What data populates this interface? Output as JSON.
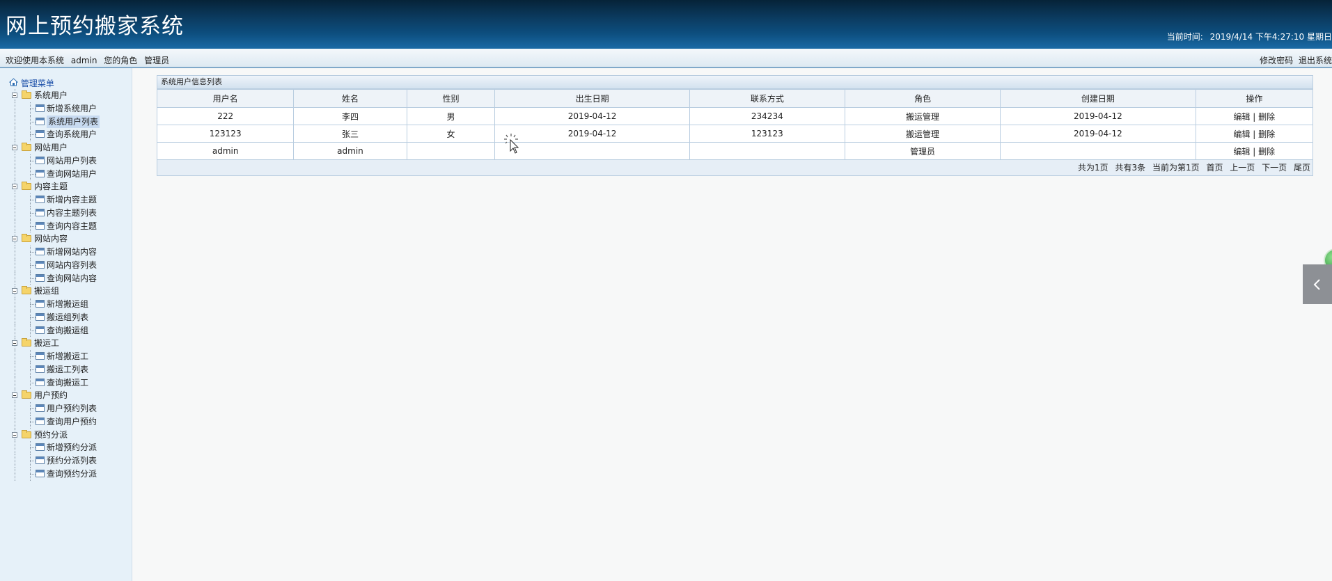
{
  "header": {
    "app_title": "网上预约搬家系统",
    "clock_label": "当前时间:",
    "clock_value": "2019/4/14 下午4:27:10 星期日"
  },
  "userbar": {
    "welcome": "欢迎使用本系统",
    "username": "admin",
    "role_label": "您的角色",
    "role": "管理员",
    "change_password": "修改密码",
    "logout": "退出系统"
  },
  "sidebar": {
    "root": "管理菜单",
    "groups": [
      {
        "label": "系统用户",
        "items": [
          "新增系统用户",
          "系统用户列表",
          "查询系统用户"
        ]
      },
      {
        "label": "网站用户",
        "items": [
          "网站用户列表",
          "查询网站用户"
        ]
      },
      {
        "label": "内容主题",
        "items": [
          "新增内容主题",
          "内容主题列表",
          "查询内容主题"
        ]
      },
      {
        "label": "网站内容",
        "items": [
          "新增网站内容",
          "网站内容列表",
          "查询网站内容"
        ]
      },
      {
        "label": "搬运组",
        "items": [
          "新增搬运组",
          "搬运组列表",
          "查询搬运组"
        ]
      },
      {
        "label": "搬运工",
        "items": [
          "新增搬运工",
          "搬运工列表",
          "查询搬运工"
        ]
      },
      {
        "label": "用户预约",
        "items": [
          "用户预约列表",
          "查询用户预约"
        ]
      },
      {
        "label": "预约分派",
        "items": [
          "新增预约分派",
          "预约分派列表",
          "查询预约分派"
        ]
      }
    ],
    "active_item": "系统用户列表"
  },
  "main": {
    "panel_title": "系统用户信息列表",
    "columns": [
      "用户名",
      "姓名",
      "性别",
      "出生日期",
      "联系方式",
      "角色",
      "创建日期",
      "操作"
    ],
    "rows": [
      {
        "username": "222",
        "name": "李四",
        "gender": "男",
        "birth": "2019-04-12",
        "contact": "234234",
        "role": "搬运管理",
        "created": "2019-04-12"
      },
      {
        "username": "123123",
        "name": "张三",
        "gender": "女",
        "birth": "2019-04-12",
        "contact": "123123",
        "role": "搬运管理",
        "created": "2019-04-12"
      },
      {
        "username": "admin",
        "name": "admin",
        "gender": "",
        "birth": "",
        "contact": "",
        "role": "管理员",
        "created": ""
      }
    ],
    "edit_label": "编辑",
    "separator": "|",
    "delete_label": "删除",
    "pager": {
      "total_pages": "共为1页",
      "total_records": "共有3条",
      "current_page": "当前为第1页",
      "first": "首页",
      "prev": "上一页",
      "next": "下一页",
      "last": "尾页"
    }
  },
  "icons": {
    "home": "home-icon",
    "folder": "folder-icon",
    "page": "page-icon",
    "collapse": "minus-box-icon",
    "side_tab": "chevron-left-icon"
  }
}
